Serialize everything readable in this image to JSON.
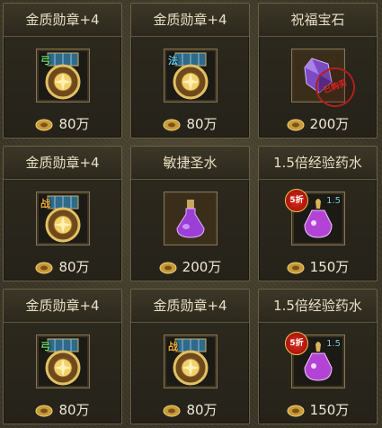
{
  "colors": {
    "title_text": "#e9dfc4",
    "price_text": "#f0e8d4",
    "frame": "#6a6046"
  },
  "items": [
    {
      "title": "金质勋章+4",
      "icon": "medal-icon",
      "class_tag": "弓",
      "class_color": "#6ae06a",
      "price": "80万"
    },
    {
      "title": "金质勋章+4",
      "icon": "medal-icon",
      "class_tag": "法",
      "class_color": "#6ad0f0",
      "price": "80万"
    },
    {
      "title": "祝福宝石",
      "icon": "gem-icon",
      "stamp": "已购买",
      "price": "200万"
    },
    {
      "title": "金质勋章+4",
      "icon": "medal-icon",
      "class_tag": "战",
      "class_color": "#f0b040",
      "price": "80万"
    },
    {
      "title": "敏捷圣水",
      "icon": "potion-icon",
      "price": "200万"
    },
    {
      "title": "1.5倍经验药水",
      "icon": "exp-potion-icon",
      "sale": "5折",
      "ratio": "1.5",
      "price": "150万"
    },
    {
      "title": "金质勋章+4",
      "icon": "medal-icon",
      "class_tag": "弓",
      "class_color": "#6ae06a",
      "price": "80万"
    },
    {
      "title": "金质勋章+4",
      "icon": "medal-icon",
      "class_tag": "战",
      "class_color": "#f0b040",
      "price": "80万"
    },
    {
      "title": "1.5倍经验药水",
      "icon": "exp-potion-icon",
      "sale": "5折",
      "ratio": "1.5",
      "price": "150万"
    }
  ]
}
